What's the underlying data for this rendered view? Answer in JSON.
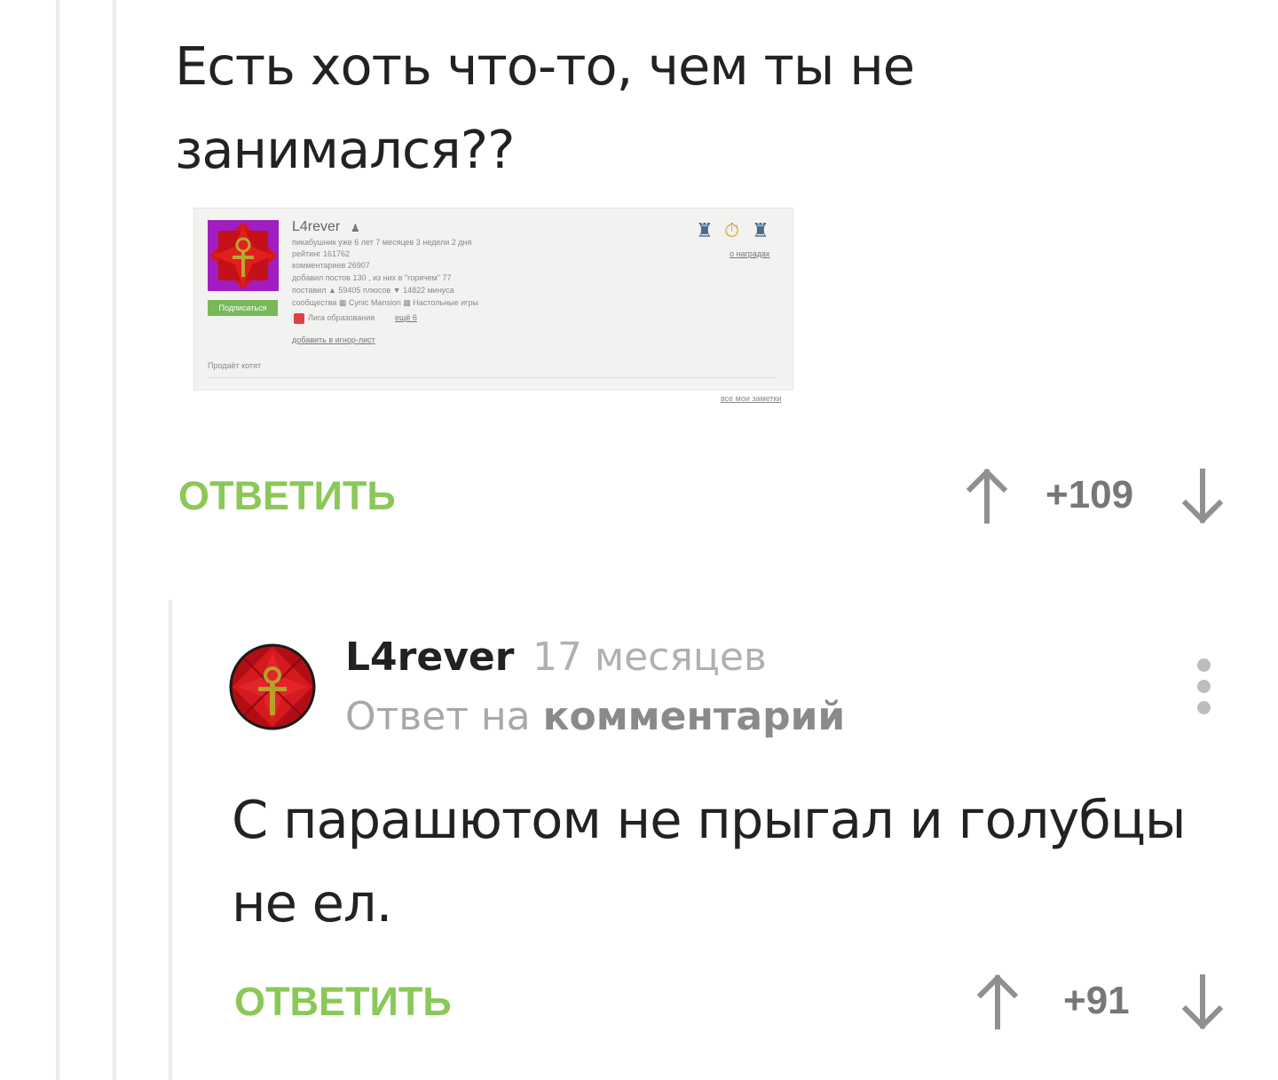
{
  "parent_comment": {
    "text_line1": "Есть хоть что-то, чем ты не",
    "text_line2": "занимался??",
    "reply_label": "ОТВЕТИТЬ",
    "rating": "+109",
    "profile_screenshot": {
      "nickname": "L4rever",
      "line_pikabushnik": "пикабушник уже 6 лет 7 месяцев 3 недели 2 дня",
      "line_rating": "рейтинг 161762",
      "line_comments": "комментариев 26907",
      "line_posts": "добавил постов 130 , из них в \"горячем\" 77",
      "line_votes": "поставил ▲ 59405 плюсов ▼ 14822 минуса",
      "line_communities": "сообщества ▦ Cynic Mansion ▦ Настольные игры",
      "line_league": "Лига образования",
      "more_link": "ещё 6",
      "ignore_link": "добавить в игнор-лист",
      "subscribe_label": "Подписаться",
      "awards_link": "о наградах",
      "note_text": "Продаёт котят",
      "notes_link": "все мои заметки"
    }
  },
  "reply_comment": {
    "author": "L4rever",
    "time": "17 месяцев",
    "reply_to_prefix": "Ответ на",
    "reply_to_link": "комментарий",
    "text_line1": "С парашютом не прыгал и голубцы",
    "text_line2": "не ел.",
    "reply_label": "ОТВЕТИТЬ",
    "rating": "+91"
  },
  "colors": {
    "reply_green": "#8ac858",
    "avatar_red": "#c4131b",
    "thread_line": "#ececec"
  },
  "icons": [
    "arrow-up-icon",
    "arrow-down-icon",
    "more-vertical-icon",
    "avatar-ankh-icon"
  ]
}
